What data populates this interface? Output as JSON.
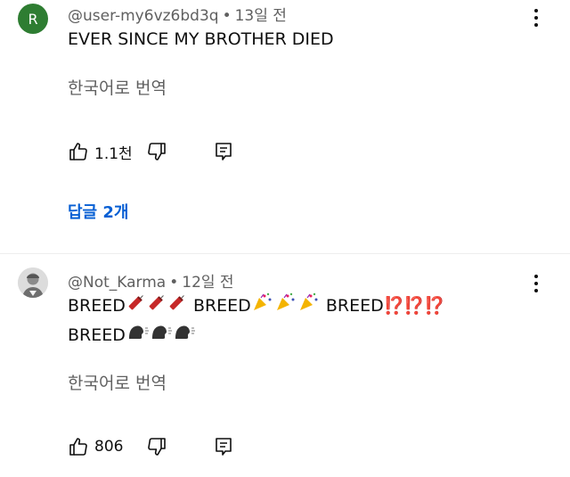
{
  "comments": [
    {
      "avatar_letter": "R",
      "username": "@user-my6vz6bd3q",
      "time": "13일 전",
      "text_line1": "EVER SINCE MY BROTHER DIED",
      "translate_label": "한국어로 번역",
      "likes": "1.1천",
      "icons": [
        "like-icon",
        "dislike-icon",
        "reply-icon",
        "more-vert-icon"
      ]
    },
    {
      "username": "@Not_Karma",
      "time": "12일 전",
      "text_words": [
        "BREED",
        "BREED",
        "BREED",
        "BREED"
      ],
      "interrobang_text": "⁉️⁉️⁉️",
      "translate_label": "한국어로 번역",
      "likes": "806",
      "icons": [
        "firecracker-icon",
        "party-popper-icon",
        "speaking-head-icon"
      ]
    }
  ],
  "replies_label": "답글 2개",
  "colors": {
    "link": "#065fd4",
    "secondary_text": "#606060",
    "avatar_bg": "#2e7d32",
    "interrobang": "#d32f2f"
  }
}
